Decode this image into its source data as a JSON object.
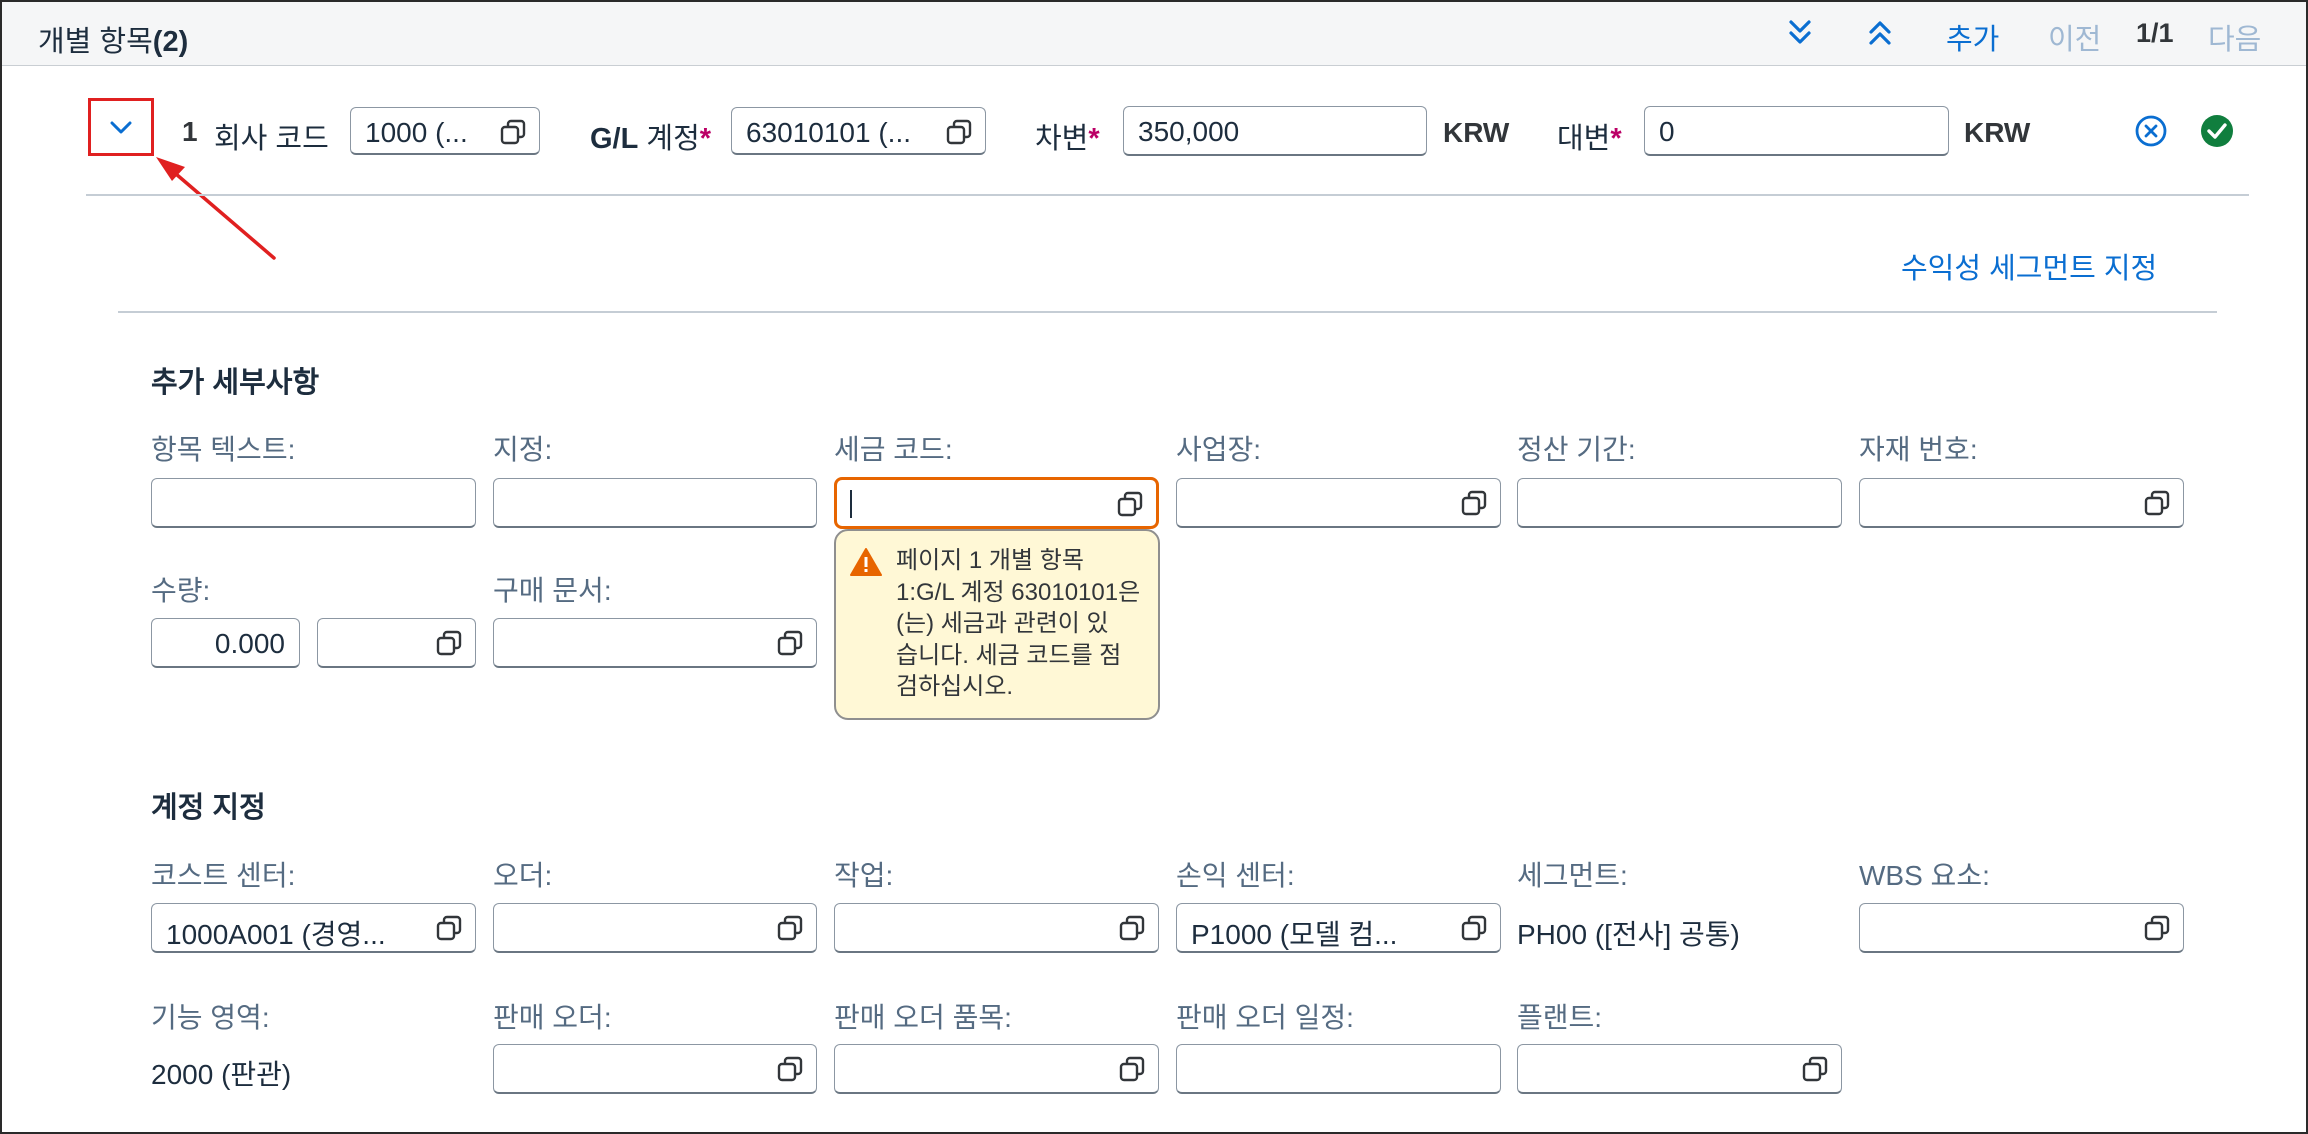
{
  "toolbar": {
    "title": "개별 항목",
    "count": "(2)",
    "add": "추가",
    "prev": "이전",
    "page": "1/1",
    "next": "다음"
  },
  "item_row": {
    "number": "1",
    "company_code_label": "회사 코드",
    "company_code_value": "1000 (...",
    "gl_account_label_prefix": "G/L",
    "gl_account_label": "계정",
    "gl_account_value": "63010101 (...",
    "debit_label": "차변",
    "debit_value": "350,000",
    "debit_currency": "KRW",
    "credit_label": "대변",
    "credit_value": "0",
    "credit_currency": "KRW",
    "required_marker": "*"
  },
  "profit_segment_link": "수익성 세그먼트 지정",
  "additional_details": {
    "title": "추가 세부사항",
    "item_text_label": "항목 텍스트:",
    "assignment_label": "지정:",
    "tax_code_label": "세금 코드:",
    "business_place_label": "사업장:",
    "settlement_period_label": "정산 기간:",
    "material_number_label": "자재 번호:",
    "quantity_label": "수량:",
    "quantity_value": "0.000",
    "purchasing_doc_label": "구매 문서:"
  },
  "tax_warning": "페이지 1 개별 항목\n1:G/L 계정 63010101은\n(는) 세금과 관련이 있\n습니다. 세금 코드를 점\n검하십시오.",
  "account_assignment": {
    "title": "계정 지정",
    "cost_center_label": "코스트 센터:",
    "cost_center_value": "1000A001 (경영...",
    "order_label": "오더:",
    "activity_label": "작업:",
    "profit_center_label": "손익 센터:",
    "profit_center_value": "P1000 (모델 컴...",
    "segment_label": "세그먼트:",
    "segment_value": "PH00 ([전사] 공통)",
    "wbs_label": "WBS 요소:",
    "functional_area_label": "기능 영역:",
    "functional_area_value": "2000 (판관)",
    "sales_order_label": "판매 오더:",
    "sales_order_item_label": "판매 오더 품목:",
    "sales_order_schedule_label": "판매 오더 일정:",
    "plant_label": "플랜트:"
  },
  "colors": {
    "link": "#0a6ed1",
    "required": "#bb0066",
    "focus": "#e76500",
    "warning": "#e76500",
    "success": "#107e3e",
    "annotation": "#e02020"
  }
}
